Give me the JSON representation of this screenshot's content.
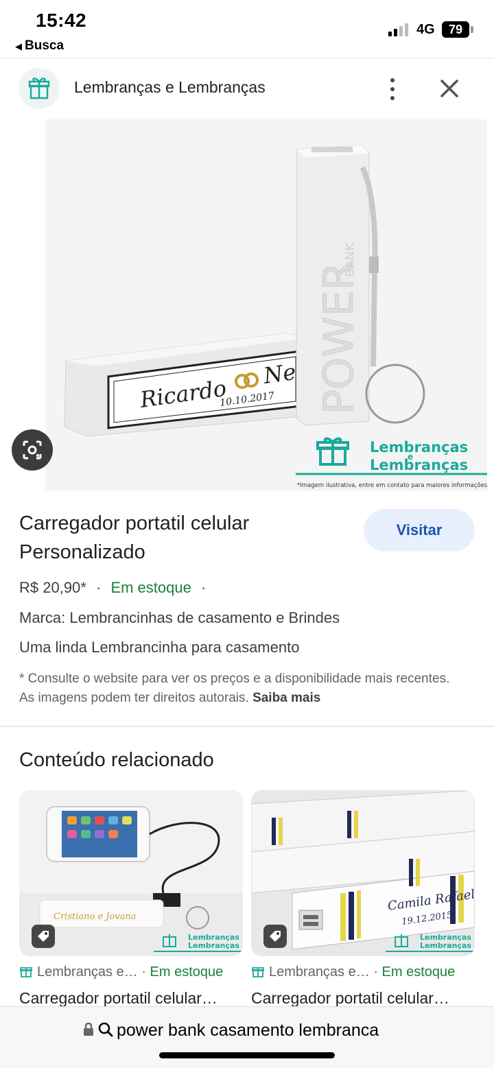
{
  "status_bar": {
    "time": "15:42",
    "back_label": "Busca",
    "network": "4G",
    "battery": "79"
  },
  "header": {
    "site_name": "Lembranças e Lembranças"
  },
  "product_image": {
    "engraving_name": "Ricardo",
    "engraving_name_2": "Ne",
    "engraving_date": "10.10.2017",
    "device_text": "POWER",
    "device_text_small": "BANK",
    "brand_line_1": "Lembranças",
    "brand_line_mid": "e",
    "brand_line_2": "Lembranças",
    "footnote": "*Imagem ilustrativa, entre em contato para maiores informações"
  },
  "product": {
    "title": "Carregador portatil celular Personalizado",
    "visit_label": "Visitar",
    "price": "R$ 20,90*",
    "separator": "·",
    "stock": "Em estoque",
    "brand": "Marca: Lembrancinhas de casamento e Brindes",
    "description": "Uma linda Lembrancinha para casamento",
    "disclaimer": "* Consulte o website para ver os preços e a disponibilidade mais recentes. As imagens podem ter direitos autorais.",
    "learn_more": "Saiba mais"
  },
  "related": {
    "title": "Conteúdo relacionado",
    "cards": [
      {
        "source": "Lembranças e…",
        "stock": "Em estoque",
        "title": "Carregador portatil celular…",
        "image_caption": "Lembranças",
        "image_caption_2": "Lembranças"
      },
      {
        "source": "Lembranças e…",
        "stock": "Em estoque",
        "title": "Carregador portatil celular…",
        "image_caption": "Lembranças",
        "image_caption_2": "Lembranças",
        "image_name": "Camila Rafael",
        "image_date": "19.12.2015"
      }
    ]
  },
  "url_bar": {
    "text": "power bank casamento lembranca"
  },
  "colors": {
    "accent_green": "#188038",
    "visit_bg": "#e8f0fe",
    "visit_text": "#1a56b0",
    "brand_teal": "#1aab9b"
  }
}
